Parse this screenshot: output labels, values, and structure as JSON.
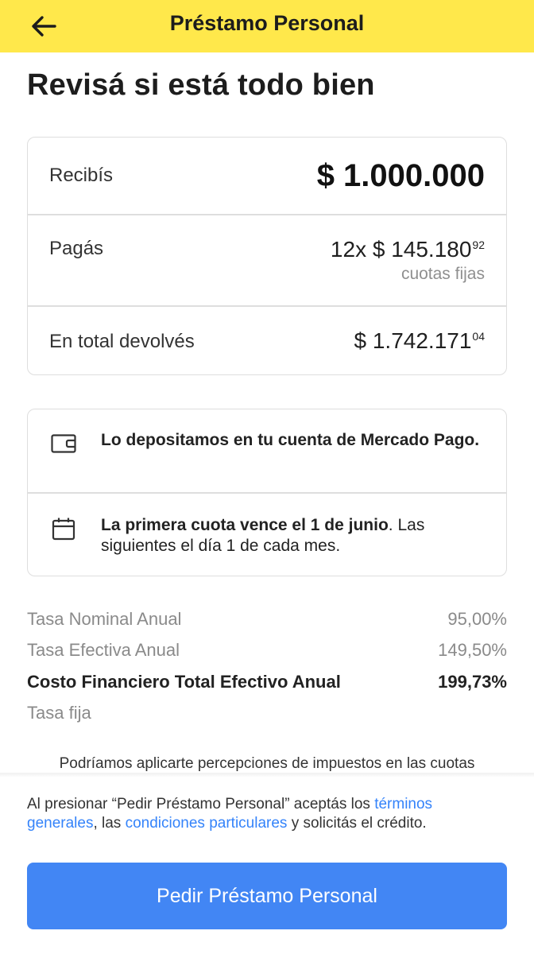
{
  "header": {
    "title": "Préstamo Personal",
    "back_icon": "arrow-left-icon"
  },
  "page": {
    "title": "Revisá si está todo bien"
  },
  "summary": {
    "receive_label": "Recibís",
    "receive_value": "$ 1.000.000",
    "pay_label": "Pagás",
    "pay_value": "12x $ 145.180",
    "pay_cents": "92",
    "pay_note": "cuotas fijas",
    "total_label": "En total devolvés",
    "total_value": "$ 1.742.171",
    "total_cents": "04"
  },
  "info": {
    "deposit_icon": "wallet-icon",
    "deposit_text": "Lo depositamos en tu cuenta de Mercado Pago.",
    "due_icon": "calendar-icon",
    "due_bold": "La primera cuota vence el 1 de junio",
    "due_rest": ". Las siguientes el día 1 de cada mes."
  },
  "rates": [
    {
      "label": "Tasa Nominal Anual",
      "value": "95,00%"
    },
    {
      "label": "Tasa Efectiva Anual",
      "value": "149,50%"
    },
    {
      "label": "Costo Financiero Total Efectivo Anual",
      "value": "199,73%"
    },
    {
      "label": "Tasa fija",
      "value": ""
    }
  ],
  "taxes_note": "Podríamos aplicarte percepciones de impuestos en las cuotas",
  "legal": {
    "prefix": "Al presionar “Pedir Préstamo Personal” aceptás los ",
    "link1": "términos generales",
    "middle": ", las ",
    "link2": "condiciones particulares",
    "suffix": " y solicitás el crédito."
  },
  "cta": {
    "label": "Pedir Préstamo Personal"
  },
  "colors": {
    "header_bg": "#ffe84b",
    "accent": "#3483fa",
    "button_bg": "#4286f4"
  }
}
